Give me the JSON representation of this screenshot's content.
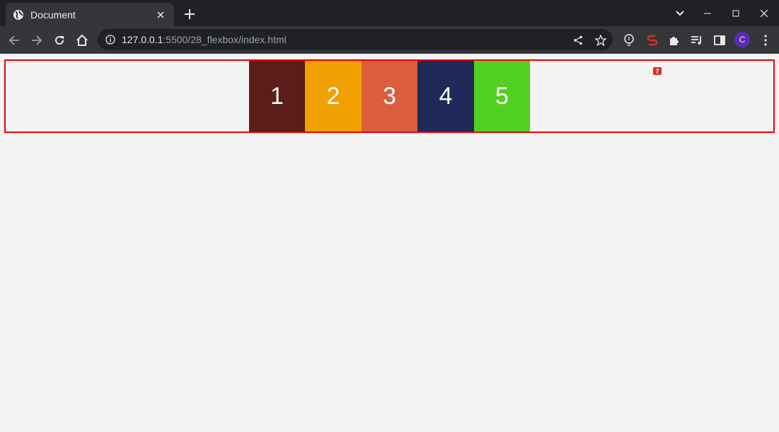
{
  "browser": {
    "tab_title": "Document",
    "url_host": "127.0.0.1",
    "url_rest": ":5500/28_flexbox/index.html",
    "avatar_letter": "C",
    "extension_badge": "7"
  },
  "page": {
    "boxes": [
      {
        "label": "1",
        "color": "#5a1d17"
      },
      {
        "label": "2",
        "color": "#f0a000"
      },
      {
        "label": "3",
        "color": "#db5d3b"
      },
      {
        "label": "4",
        "color": "#1f2a58"
      },
      {
        "label": "5",
        "color": "#51d021"
      }
    ],
    "container_border_color": "#ee0000",
    "background_color": "#f3f3f3"
  }
}
